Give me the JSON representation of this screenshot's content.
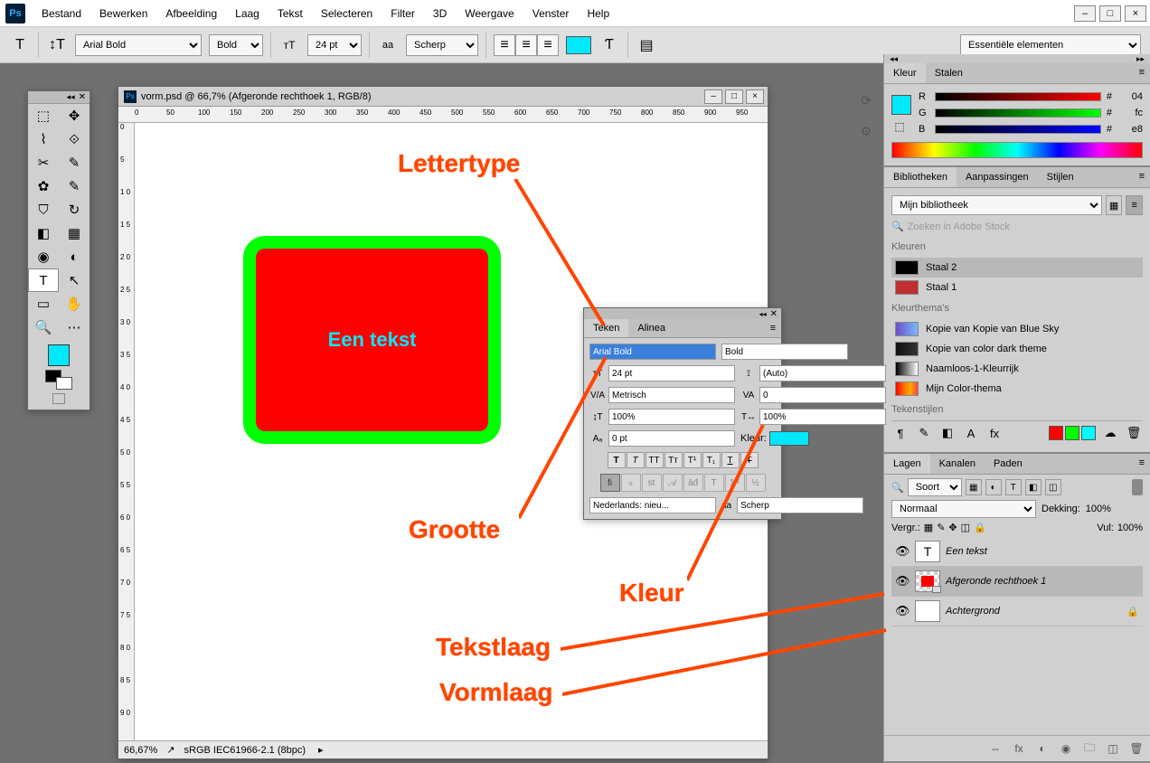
{
  "menu": {
    "items": [
      "Bestand",
      "Bewerken",
      "Afbeelding",
      "Laag",
      "Tekst",
      "Selecteren",
      "Filter",
      "3D",
      "Weergave",
      "Venster",
      "Help"
    ]
  },
  "options": {
    "font": "Arial Bold",
    "weight": "Bold",
    "size": "24 pt",
    "aa_label": "aa",
    "aa_mode": "Scherp",
    "color_hex": "#00e8fc"
  },
  "workspace_dropdown": "Essentiële elementen",
  "document": {
    "title": "vorm.psd @ 66,7% (Afgeronde rechthoek 1, RGB/8)",
    "zoom": "66,67%",
    "profile": "sRGB IEC61966-2.1 (8bpc)"
  },
  "ruler_h": [
    "0",
    "50",
    "100",
    "150",
    "200",
    "250",
    "300",
    "350",
    "400",
    "450",
    "500",
    "550",
    "600",
    "650",
    "700",
    "750",
    "800",
    "850",
    "900",
    "950"
  ],
  "ruler_v": [
    "0",
    "5",
    "1 0",
    "1 5",
    "2 0",
    "2 5",
    "3 0",
    "3 5",
    "4 0",
    "4 5",
    "5 0",
    "5 5",
    "6 0",
    "6 5",
    "7 0",
    "7 5",
    "8 0",
    "8 5",
    "9 0"
  ],
  "shape_text": "Een tekst",
  "char_panel": {
    "tabs": [
      "Teken",
      "Alinea"
    ],
    "font": "Arial Bold",
    "weight": "Bold",
    "size": "24 pt",
    "leading": "(Auto)",
    "kern": "Metrisch",
    "track": "0",
    "scale_v": "100%",
    "scale_h": "100%",
    "baseline": "0 pt",
    "color_label": "Kleur:",
    "lang": "Nederlands: nieu...",
    "aa": "aa",
    "aa_mode": "Scherp"
  },
  "annotations": {
    "lettertype": "Lettertype",
    "grootte": "Grootte",
    "kleur": "Kleur",
    "tekstlaag": "Tekstlaag",
    "vormlaag": "Vormlaag"
  },
  "color_panel": {
    "tabs": [
      "Kleur",
      "Stalen"
    ],
    "r": "04",
    "g": "fc",
    "b": "e8"
  },
  "libraries": {
    "tabs": [
      "Bibliotheken",
      "Aanpassingen",
      "Stijlen"
    ],
    "library": "Mijn bibliotheek",
    "search": "Zoeken in Adobe Stock",
    "colors_header": "Kleuren",
    "colors": [
      {
        "name": "Staal 2",
        "hex": "#000000"
      },
      {
        "name": "Staal 1",
        "hex": "#c03030"
      }
    ],
    "themes_header": "Kleurthema's",
    "themes": [
      {
        "name": "Kopie van Kopie van Blue Sky",
        "grad": "linear-gradient(to right,#6b4fc9,#7bb8ff)"
      },
      {
        "name": "Kopie van color dark theme",
        "grad": "linear-gradient(to right,#111,#222,#333)"
      },
      {
        "name": "Naamloos-1-Kleurrijk",
        "grad": "linear-gradient(to right,#000,#fff)"
      },
      {
        "name": "Mijn Color-thema",
        "grad": "linear-gradient(to right,#f00,#f60,#fa0,#f44)"
      }
    ],
    "textstyles_header": "Tekenstijlen"
  },
  "layers": {
    "tabs": [
      "Lagen",
      "Kanalen",
      "Paden"
    ],
    "filter": "Soort",
    "mode": "Normaal",
    "opacity_label": "Dekking:",
    "opacity": "100%",
    "fill_label": "Vul:",
    "fill": "100%",
    "lock_label": "Vergr.:",
    "items": [
      {
        "name": "Een tekst",
        "type": "T"
      },
      {
        "name": "Afgeronde rechthoek 1",
        "type": "shape",
        "selected": true
      },
      {
        "name": "Achtergrond",
        "type": "bg",
        "locked": true
      }
    ]
  }
}
